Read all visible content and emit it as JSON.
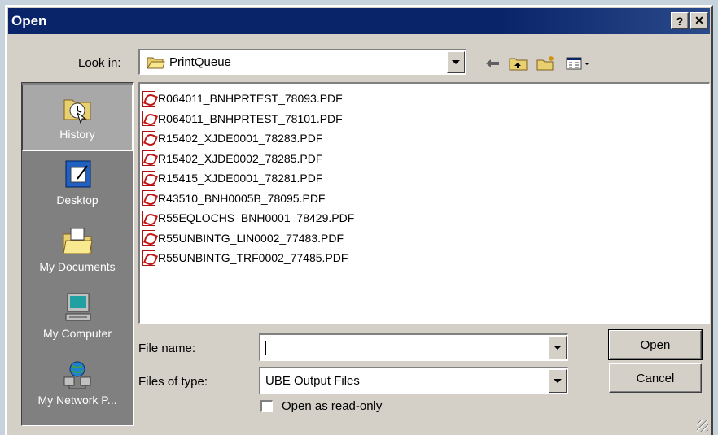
{
  "dialog": {
    "title": "Open",
    "help_label": "?",
    "close_label": "✕"
  },
  "toolbar": {
    "look_in_label": "Look in:",
    "look_in_value": "PrintQueue"
  },
  "places": [
    {
      "label": "History",
      "icon": "history-icon",
      "selected": true
    },
    {
      "label": "Desktop",
      "icon": "desktop-icon"
    },
    {
      "label": "My Documents",
      "icon": "my-documents-icon"
    },
    {
      "label": "My Computer",
      "icon": "my-computer-icon"
    },
    {
      "label": "My Network P...",
      "icon": "my-network-places-icon"
    }
  ],
  "files": [
    "R064011_BNHPRTEST_78093.PDF",
    "R064011_BNHPRTEST_78101.PDF",
    "R15402_XJDE0001_78283.PDF",
    "R15402_XJDE0002_78285.PDF",
    "R15415_XJDE0001_78281.PDF",
    "R43510_BNH0005B_78095.PDF",
    "R55EQLOCHS_BNH0001_78429.PDF",
    "R55UNBINTG_LIN0002_77483.PDF",
    "R55UNBINTG_TRF0002_77485.PDF"
  ],
  "form": {
    "file_name_label": "File name:",
    "file_name_value": "",
    "file_type_label": "Files of type:",
    "file_type_value": "UBE Output Files",
    "read_only_label": "Open as read-only"
  },
  "buttons": {
    "open": "Open",
    "cancel": "Cancel"
  },
  "colors": {
    "title_bar": "#0a246a",
    "dialog_bg": "#d4d0c8",
    "places_bg": "#808080"
  }
}
